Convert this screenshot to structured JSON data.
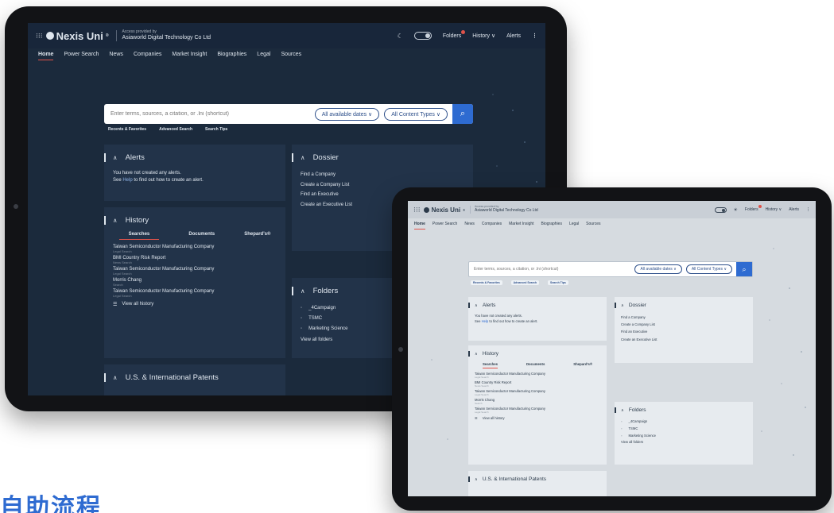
{
  "colors": {
    "accent_blue": "#2e6bd1",
    "tab_underline": "#e0534a",
    "badge_red": "#e0534a"
  },
  "app": {
    "brand": "Nexis Uni",
    "brand_mark": "®",
    "provided_by_label": "Access provided by",
    "provided_by_org": "Asiaworld Digital Technology Co Ltd"
  },
  "topbar": {
    "folders": "Folders",
    "history": "History",
    "alerts": "Alerts",
    "history_chevron": "∨",
    "kebab": "⋮",
    "grid_icon": "⁝⁝⁝"
  },
  "nav": [
    "Home",
    "Power Search",
    "News",
    "Companies",
    "Market Insight",
    "Biographies",
    "Legal",
    "Sources"
  ],
  "search": {
    "placeholder": "Enter terms, sources, a citation, or .lni (shortcut)",
    "dates_pill": "All available dates ∨",
    "content_pill": "All Content Types ∨",
    "search_icon": "⌕",
    "links": [
      "Recents & Favorites",
      "Advanced Search",
      "Search Tips"
    ]
  },
  "alerts": {
    "title": "Alerts",
    "line1": "You have not created any alerts.",
    "line2_pre": "See ",
    "line2_link": "Help",
    "line2_post": " to find out how to create an alert."
  },
  "dossier": {
    "title": "Dossier",
    "items": [
      "Find a Company",
      "Create a Company List",
      "Find an Executive",
      "Create an Executive List"
    ]
  },
  "history": {
    "title": "History",
    "tabs": [
      "Searches",
      "Documents",
      "Shepard's®"
    ],
    "items": [
      {
        "title": "Taiwan Semiconductor Manufacturing Company",
        "sub": "Legal Search"
      },
      {
        "title": "BMI Country Risk Report",
        "sub": "News Search"
      },
      {
        "title": "Taiwan Semiconductor Manufacturing Company",
        "sub": "Legal Search"
      },
      {
        "title": "Morris Chang",
        "sub": "Search"
      },
      {
        "title": "Taiwan Semiconductor Manufacturing Company",
        "sub": "Legal Search"
      }
    ],
    "view_all": "View all history",
    "view_all_icon": "☰"
  },
  "folders": {
    "title": "Folders",
    "items": [
      "_4Campaign",
      "TSMC",
      "Marketing Science"
    ],
    "view_all": "View all folders"
  },
  "patents": {
    "title": "U.S. & International Patents"
  },
  "chevron_up": "∧",
  "caption": "自助流程"
}
